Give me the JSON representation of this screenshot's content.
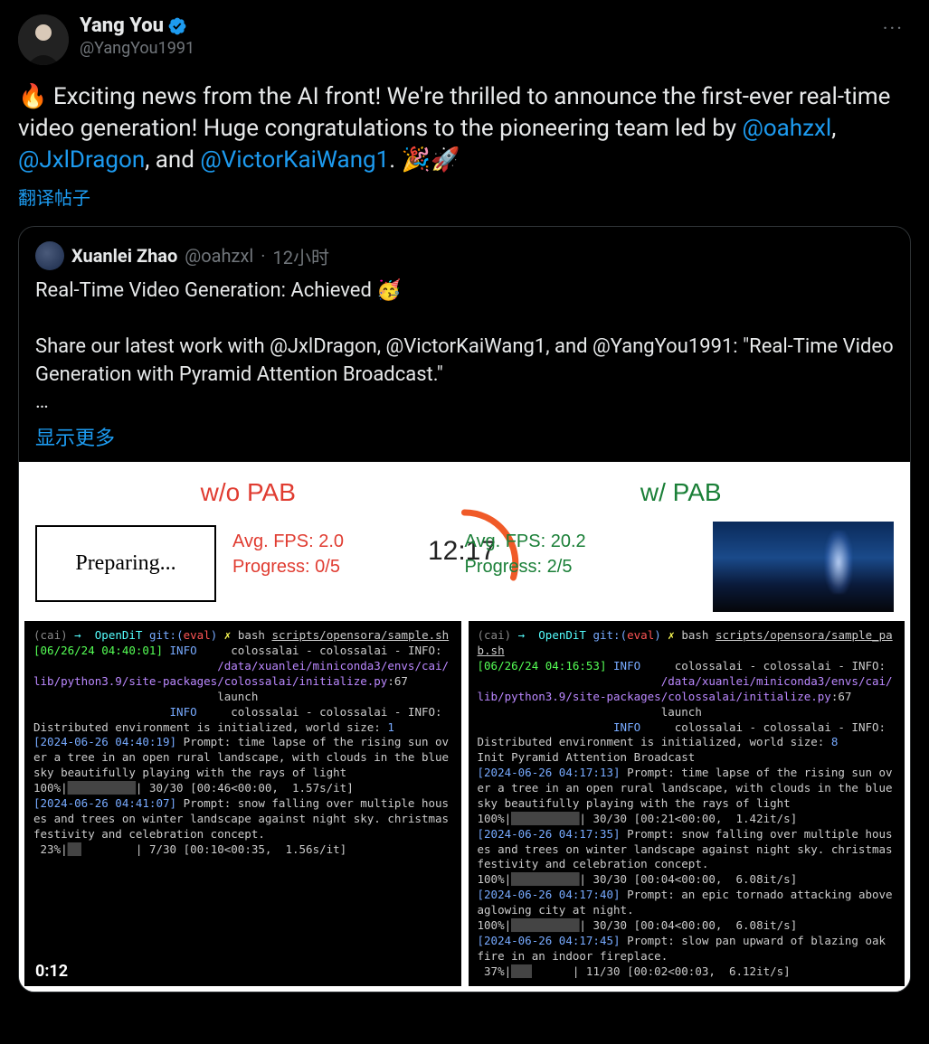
{
  "author": {
    "display_name": "Yang You",
    "handle": "@YangYou1991",
    "verified": true
  },
  "more_label": "···",
  "tweet": {
    "text_pre": "🔥 Exciting news from the AI front! We're thrilled to announce the first-ever real-time video generation! Huge congratulations to the pioneering team led by ",
    "mention1": "@oahzxl",
    "sep1": ", ",
    "mention2": "@JxlDragon",
    "sep2": ", and ",
    "mention3": "@VictorKaiWang1",
    "text_post": ". 🎉🚀",
    "translate": "翻译帖子"
  },
  "quote": {
    "author_name": "Xuanlei Zhao",
    "author_handle": "@oahzxl",
    "dot": "·",
    "time": "12小时",
    "line1": "Real-Time Video Generation: Achieved 🥳",
    "line2": "",
    "line3": "Share our latest work with @JxlDragon, @VictorKaiWang1, and @YangYou1991: \"Real-Time Video Generation with Pyramid Attention Broadcast.\"",
    "ellipsis": "…",
    "show_more": "显示更多"
  },
  "media": {
    "duration": "0:12"
  },
  "chart_data": {
    "type": "table",
    "timer": "12:17",
    "left": {
      "title": "w/o PAB",
      "status_box": "Preparing...",
      "fps_label": "Avg. FPS: ",
      "fps_value": "2.0",
      "progress_label": "Progress: ",
      "progress_value": "0/5"
    },
    "right": {
      "title": "w/ PAB",
      "fps_label": "Avg. FPS: ",
      "fps_value": "20.2",
      "progress_label": "Progress: ",
      "progress_value": "2/5"
    }
  },
  "terminal_left": {
    "prompt_env": "(cai)",
    "arrow": "→",
    "repo": "OpenDiT",
    "git": "git:(",
    "branch": "eval",
    "git_close": ")",
    "x": "✗",
    "cmd": "bash",
    "script": "scripts/opensora/sample.sh",
    "ts1": "[06/26/24 04:40:01]",
    "lvl": "INFO",
    "msg1": "colossalai - colossalai - INFO:",
    "path1": "/data/xuanlei/miniconda3/envs/cai/lib/python3.9/site-packages/colossalai/initialize.py",
    "path1_ln": ":67",
    "launch": "launch",
    "msg2": "colossalai - colossalai - INFO: Distributed environment is initialized, world size: ",
    "ws": "1",
    "ts2": "[2024-06-26 04:40:19]",
    "prompt1": " Prompt: time lapse of the rising sun over a tree in an open rural landscape, with clouds in the blue sky beautifully playing with the rays of light",
    "prog1": "100%|",
    "bar1": "██████████",
    "prog1b": "| 30/30 [00:46<00:00,  1.57s/it]",
    "ts3": "[2024-06-26 04:41:07]",
    "prompt2": " Prompt: snow falling over multiple houses and trees on winter landscape against night sky. christmas festivity and celebration concept.",
    "prog2": " 23%|",
    "bar2": "██",
    "prog2b": "        | 7/30 [00:10<00:35,  1.56s/it]"
  },
  "terminal_right": {
    "prompt_env": "(cai)",
    "arrow": "→",
    "repo": "OpenDiT",
    "git": "git:(",
    "branch": "eval",
    "git_close": ")",
    "x": "✗",
    "cmd": "bash",
    "script": "scripts/opensora/sample_pab.sh",
    "ts1": "[06/26/24 04:16:53]",
    "lvl": "INFO",
    "msg1": "colossalai - colossalai - INFO:",
    "path1": "/data/xuanlei/miniconda3/envs/cai/lib/python3.9/site-packages/colossalai/initialize.py",
    "path1_ln": ":67",
    "launch": "launch",
    "msg2": "colossalai - colossalai - INFO: Distributed environment is initialized, world size: ",
    "ws": "8",
    "init": "Init Pyramid Attention Broadcast",
    "ts2": "[2024-06-26 04:17:13]",
    "prompt1": " Prompt: time lapse of the rising sun over a tree in an open rural landscape, with clouds in the blue sky beautifully playing with the rays of light",
    "prog1": "100%|",
    "bar1": "██████████",
    "prog1b": "| 30/30 [00:21<00:00,  1.42it/s]",
    "ts3": "[2024-06-26 04:17:35]",
    "prompt2": " Prompt: snow falling over multiple houses and trees on winter landscape against night sky. christmas festivity and celebration concept.",
    "prog2": "100%|",
    "bar2": "██████████",
    "prog2b": "| 30/30 [00:04<00:00,  6.08it/s]",
    "ts4": "[2024-06-26 04:17:40]",
    "prompt3": " Prompt: an epic tornado attacking above aglowing city at night.",
    "prog3": "100%|",
    "bar3": "██████████",
    "prog3b": "| 30/30 [00:04<00:00,  6.08it/s]",
    "ts5": "[2024-06-26 04:17:45]",
    "prompt4": " Prompt: slow pan upward of blazing oak fire in an indoor fireplace.",
    "prog4": " 37%|",
    "bar4": "███",
    "prog4b": "      | 11/30 [00:02<00:03,  6.12it/s]"
  }
}
